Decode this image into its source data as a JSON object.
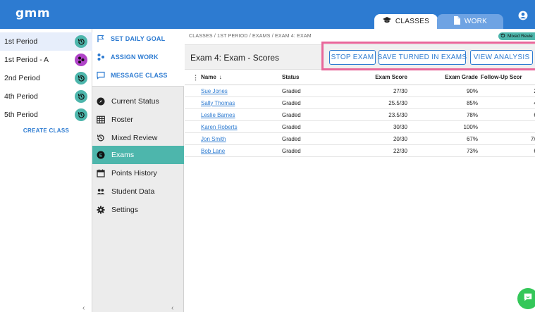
{
  "header": {
    "logo": "gmm",
    "tabs": [
      {
        "label": "CLASSES",
        "icon": "graduation-cap-icon",
        "active": true
      },
      {
        "label": "WORK",
        "icon": "document-icon",
        "active": false
      }
    ],
    "user_icon": "user-circle-icon"
  },
  "classes": {
    "items": [
      {
        "label": "1st Period",
        "badge": "mixed-review-icon",
        "badge_color": "#4db6ac",
        "active": true
      },
      {
        "label": "1st Period - A",
        "badge": "group-icon",
        "badge_color": "#b044c8",
        "active": false
      },
      {
        "label": "2nd Period",
        "badge": "mixed-review-icon",
        "badge_color": "#4db6ac",
        "active": false
      },
      {
        "label": "4th Period",
        "badge": "mixed-review-icon",
        "badge_color": "#4db6ac",
        "active": false
      },
      {
        "label": "5th Period",
        "badge": "mixed-review-icon",
        "badge_color": "#4db6ac",
        "active": false
      }
    ],
    "create_label": "CREATE CLASS"
  },
  "nav": {
    "actions": [
      {
        "label": "SET DAILY GOAL",
        "icon": "flag-icon"
      },
      {
        "label": "ASSIGN WORK",
        "icon": "assign-icon"
      },
      {
        "label": "MESSAGE CLASS",
        "icon": "message-icon"
      }
    ],
    "items": [
      {
        "label": "Current Status",
        "icon": "compass-icon",
        "active": false
      },
      {
        "label": "Roster",
        "icon": "grid-icon",
        "active": false
      },
      {
        "label": "Mixed Review",
        "icon": "history-icon",
        "active": false
      },
      {
        "label": "Exams",
        "icon": "exam-icon",
        "active": true
      },
      {
        "label": "Points History",
        "icon": "calendar-icon",
        "active": false
      },
      {
        "label": "Student Data",
        "icon": "people-icon",
        "active": false
      },
      {
        "label": "Settings",
        "icon": "gear-icon",
        "active": false
      }
    ]
  },
  "main": {
    "breadcrumb": "CLASSES / 1ST PERIOD / EXAMS / EXAM 4: EXAM",
    "badge": "Mixed Revie",
    "title": "Exam 4: Exam - Scores",
    "buttons": {
      "stop": "STOP EXAM",
      "save": "SAVE TURNED IN EXAMS",
      "view": "VIEW ANALYSIS"
    },
    "highlight_color": "#e8679a",
    "table": {
      "headers": {
        "name": "Name",
        "sort": "↓",
        "status": "Status",
        "score": "Exam Score",
        "grade": "Exam Grade",
        "follow": "Follow-Up Scor"
      },
      "rows": [
        {
          "name": "Sue Jones",
          "status": "Graded",
          "score": "27/30",
          "grade": "90%",
          "follow": "2/"
        },
        {
          "name": "Sally Thomas",
          "status": "Graded",
          "score": "25.5/30",
          "grade": "85%",
          "follow": "4/"
        },
        {
          "name": "Leslie Barnes",
          "status": "Graded",
          "score": "23.5/30",
          "grade": "78%",
          "follow": "6/"
        },
        {
          "name": "Karen Roberts",
          "status": "Graded",
          "score": "30/30",
          "grade": "100%",
          "follow": ""
        },
        {
          "name": "Jon Smith",
          "status": "Graded",
          "score": "20/30",
          "grade": "67%",
          "follow": "7/1"
        },
        {
          "name": "Bob Lane",
          "status": "Graded",
          "score": "22/30",
          "grade": "73%",
          "follow": "6/"
        }
      ]
    }
  },
  "colors": {
    "brand": "#2d7bd1",
    "accent": "#4db6ac",
    "chat": "#34c759"
  }
}
